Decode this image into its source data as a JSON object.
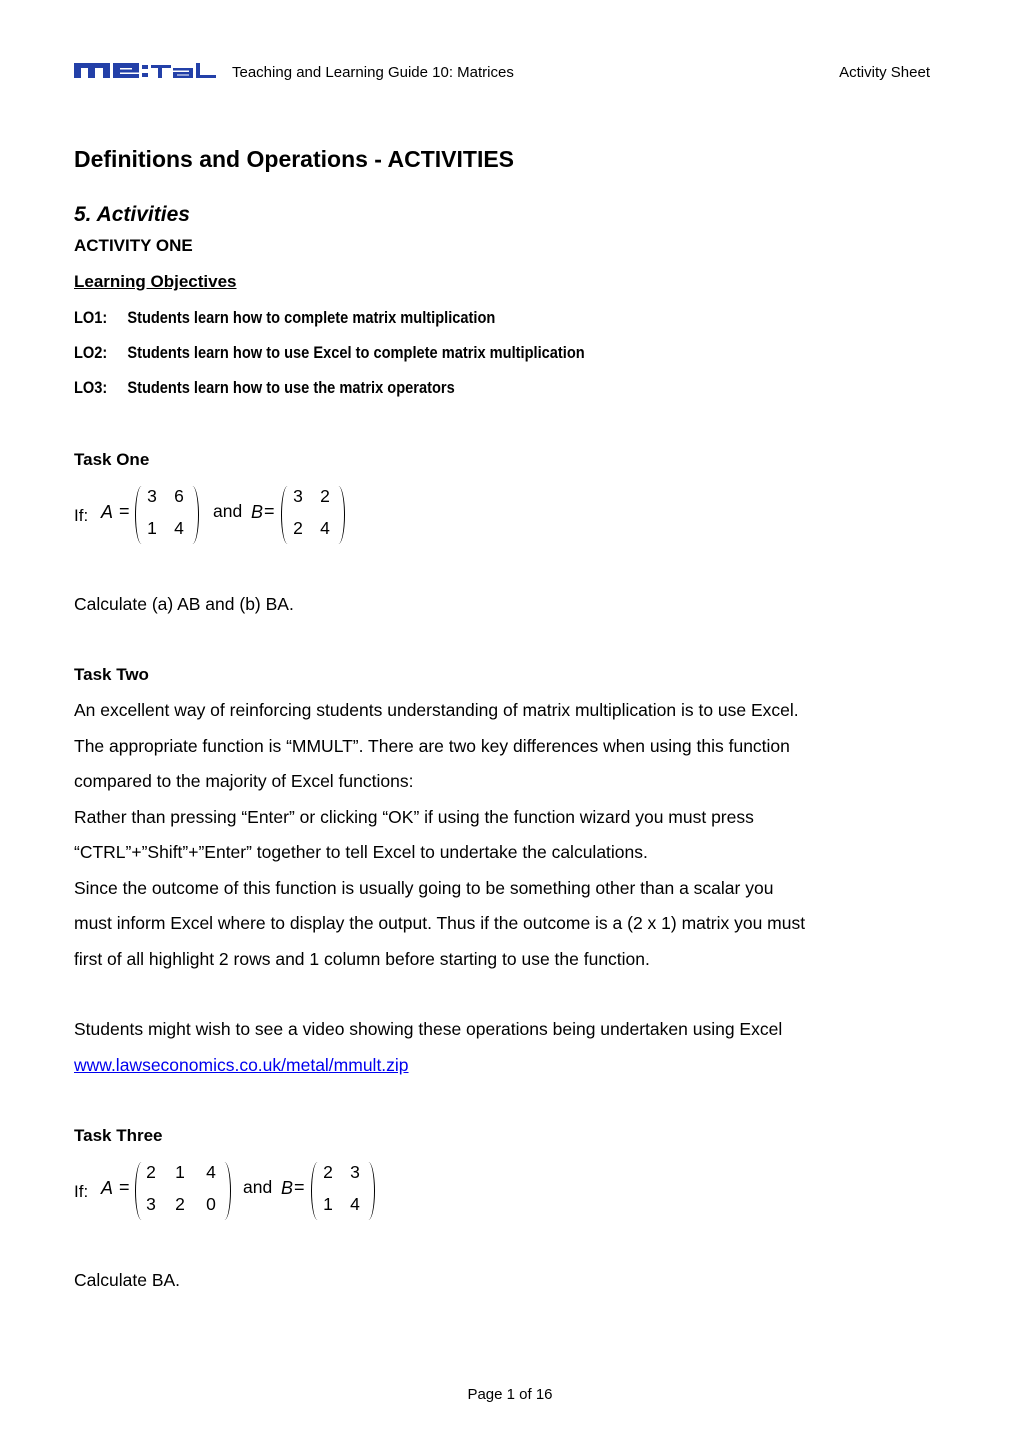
{
  "header": {
    "logo_text": "me:tal",
    "logo_color": "#2340A8",
    "title": "Teaching and Learning Guide 10: Matrices",
    "right_label": "Activity Sheet"
  },
  "page_title": "Definitions and Operations - ACTIVITIES",
  "section_title": "5. Activities",
  "activity_title": "ACTIVITY ONE",
  "learning_objectives": {
    "heading": "Learning Objectives",
    "items": [
      {
        "code": "LO1:",
        "text": "Students learn how to complete matrix multiplication"
      },
      {
        "code": "LO2:",
        "text": "Students learn how to use Excel to complete matrix multiplication"
      },
      {
        "code": "LO3:",
        "text": "Students learn how to use the matrix operators"
      }
    ]
  },
  "task_one": {
    "heading": "Task One",
    "if_label": "If:",
    "var_a": "A",
    "equals": "=",
    "and_label": "and",
    "var_b": "B",
    "matrix_a": [
      [
        "3",
        "6"
      ],
      [
        "1",
        "4"
      ]
    ],
    "matrix_b": [
      [
        "3",
        "2"
      ],
      [
        "2",
        "4"
      ]
    ],
    "instruction": "Calculate (a) AB and (b) BA."
  },
  "task_two": {
    "heading": "Task Two",
    "lines": [
      "An excellent way of reinforcing students understanding of matrix multiplication is to use Excel.",
      "The appropriate function is “MMULT”. There are two key differences when using this function",
      "compared to the majority of Excel functions:",
      "Rather than pressing “Enter” or clicking “OK” if using the function wizard you must press",
      "“CTRL”+”Shift”+”Enter” together to tell Excel to undertake the calculations.",
      "Since the outcome of this function is usually going to be something other than a scalar you",
      "must inform Excel where to display the output. Thus if the outcome is a (2 x 1) matrix you must",
      "first of all highlight 2 rows and 1 column before starting to use the function."
    ],
    "video_note": "Students might wish to see a video showing these operations being undertaken using Excel",
    "link_text": "www.lawseconomics.co.uk/metal/mmult.zip",
    "link_color": "#0000EE"
  },
  "task_three": {
    "heading": "Task Three",
    "if_label": "If:",
    "var_a": "A",
    "equals": "=",
    "and_label": "and",
    "var_b": "B",
    "matrix_a": [
      [
        "2",
        "1",
        "4"
      ],
      [
        "3",
        "2",
        "0"
      ]
    ],
    "matrix_b": [
      [
        "2",
        "3"
      ],
      [
        "1",
        "4"
      ]
    ],
    "instruction": "Calculate BA."
  },
  "footer": {
    "page_label": "Page 1 of 16"
  }
}
